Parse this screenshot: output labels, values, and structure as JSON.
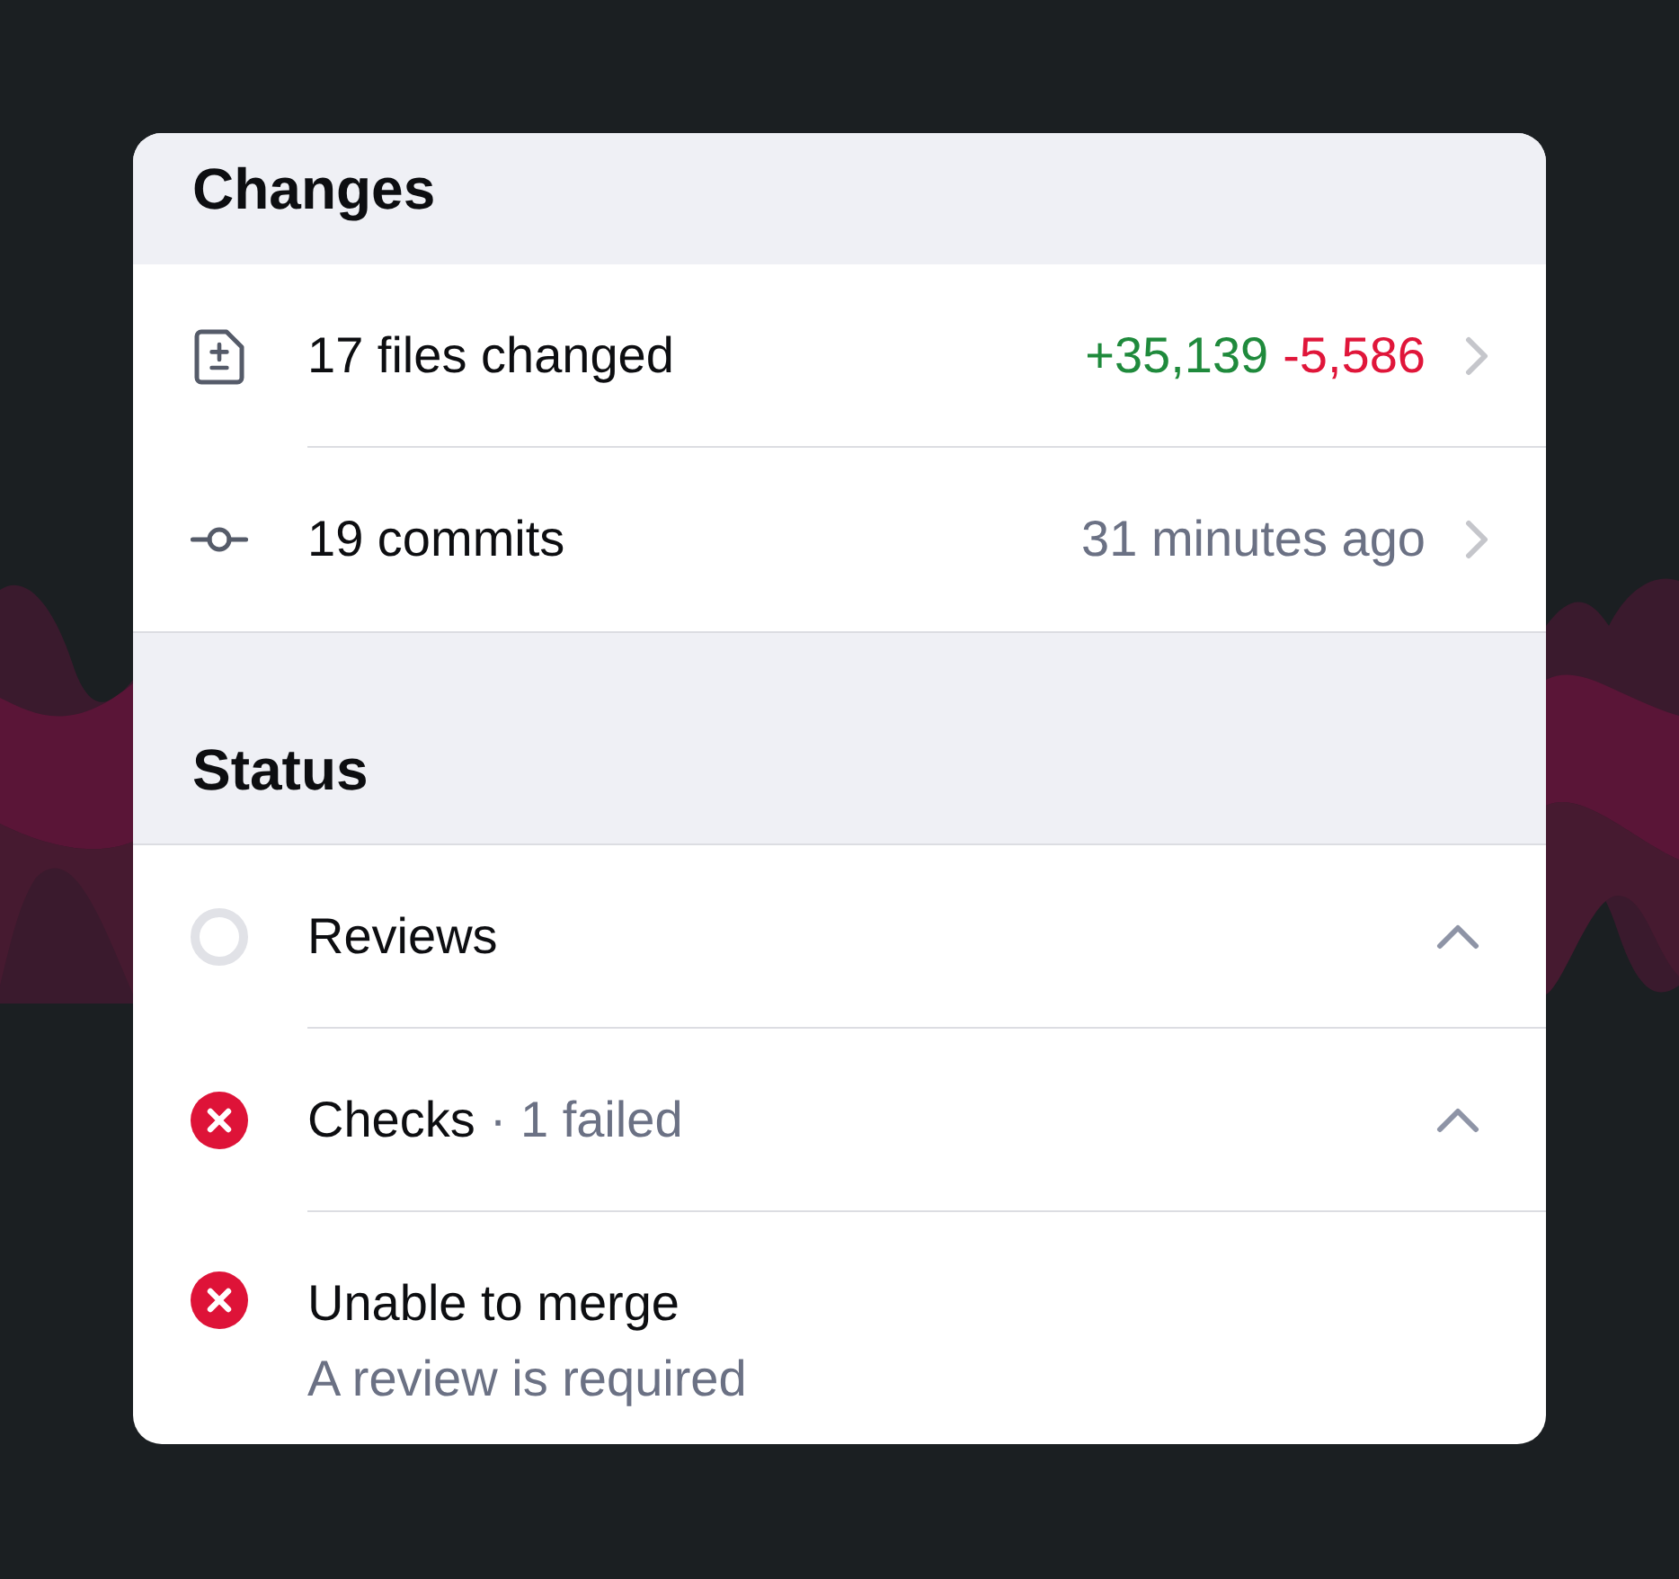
{
  "sections": [
    {
      "title": "Changes",
      "rows": [
        {
          "kind": "files",
          "label": "17 files changed",
          "additions": "+35,139",
          "deletions": "-5,586"
        },
        {
          "kind": "commits",
          "label": "19 commits",
          "time": "31 minutes ago"
        }
      ]
    },
    {
      "title": "Status",
      "rows": [
        {
          "kind": "status",
          "failed": false,
          "label": "Reviews",
          "collapsible": true
        },
        {
          "kind": "status",
          "failed": true,
          "label": "Checks",
          "detail": "· 1 failed",
          "collapsible": true
        },
        {
          "kind": "status",
          "failed": true,
          "label": "Unable to merge",
          "subtitle": "A review is required",
          "collapsible": false
        }
      ]
    }
  ]
}
